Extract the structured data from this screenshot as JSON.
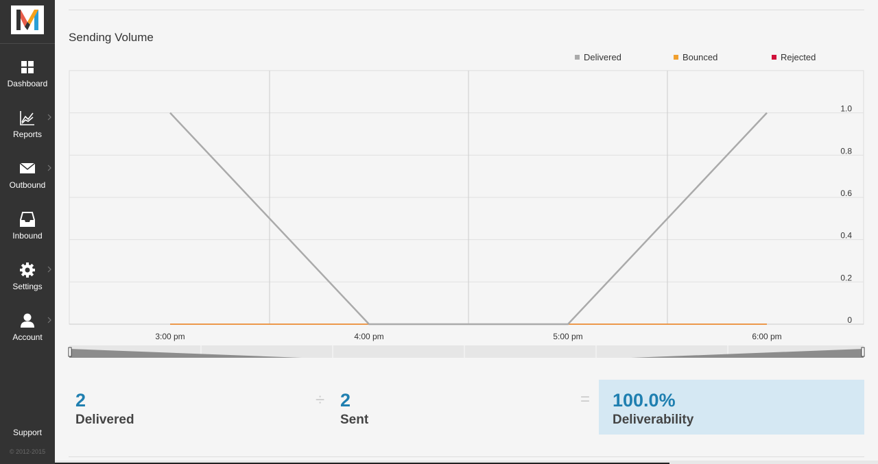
{
  "sidebar": {
    "logo": "mandrill-logo",
    "items": [
      {
        "label": "Dashboard",
        "icon": "grid-icon",
        "has_chevron": false
      },
      {
        "label": "Reports",
        "icon": "chart-line-icon",
        "has_chevron": true
      },
      {
        "label": "Outbound",
        "icon": "envelope-icon",
        "has_chevron": true
      },
      {
        "label": "Inbound",
        "icon": "inbox-icon",
        "has_chevron": false
      },
      {
        "label": "Settings",
        "icon": "gear-icon",
        "has_chevron": true
      },
      {
        "label": "Account",
        "icon": "user-icon",
        "has_chevron": true
      }
    ],
    "support_label": "Support",
    "copyright": "© 2012-2015"
  },
  "main": {
    "title": "Sending Volume",
    "stats": {
      "delivered_value": "2",
      "delivered_label": "Delivered",
      "divide_symbol": "÷",
      "sent_value": "2",
      "sent_label": "Sent",
      "equals_symbol": "=",
      "deliverability_value": "100.0%",
      "deliverability_label": "Deliverability"
    }
  },
  "colors": {
    "delivered": "#aaaaaa",
    "bounced": "#f0a030",
    "rejected": "#d0103a",
    "accent": "#1f7fb0",
    "sidebar": "#333333"
  },
  "chart_data": {
    "type": "line",
    "legend": [
      {
        "name": "Delivered",
        "color": "#aaaaaa"
      },
      {
        "name": "Bounced",
        "color": "#f0a030"
      },
      {
        "name": "Rejected",
        "color": "#d0103a"
      }
    ],
    "legend_position": "top-right",
    "x": [
      "3:00 pm",
      "4:00 pm",
      "5:00 pm",
      "6:00 pm"
    ],
    "x_tick_labels": [
      "3:00 pm",
      "4:00 pm",
      "5:00 pm",
      "6:00 pm"
    ],
    "series": [
      {
        "name": "Delivered",
        "values": [
          1,
          0,
          0,
          1
        ]
      },
      {
        "name": "Bounced",
        "values": [
          0,
          0,
          0,
          0
        ]
      },
      {
        "name": "Rejected",
        "values": [
          0,
          0,
          0,
          0
        ]
      }
    ],
    "y_ticks": [
      0,
      0.2,
      0.4,
      0.6,
      0.8,
      1.0
    ],
    "y_tick_labels": [
      "0",
      "0.2",
      "0.4",
      "0.6",
      "0.8",
      "1.0"
    ],
    "ylim": [
      0,
      1.2
    ],
    "y_axis_side": "right",
    "grid": true,
    "range_selector": true
  }
}
